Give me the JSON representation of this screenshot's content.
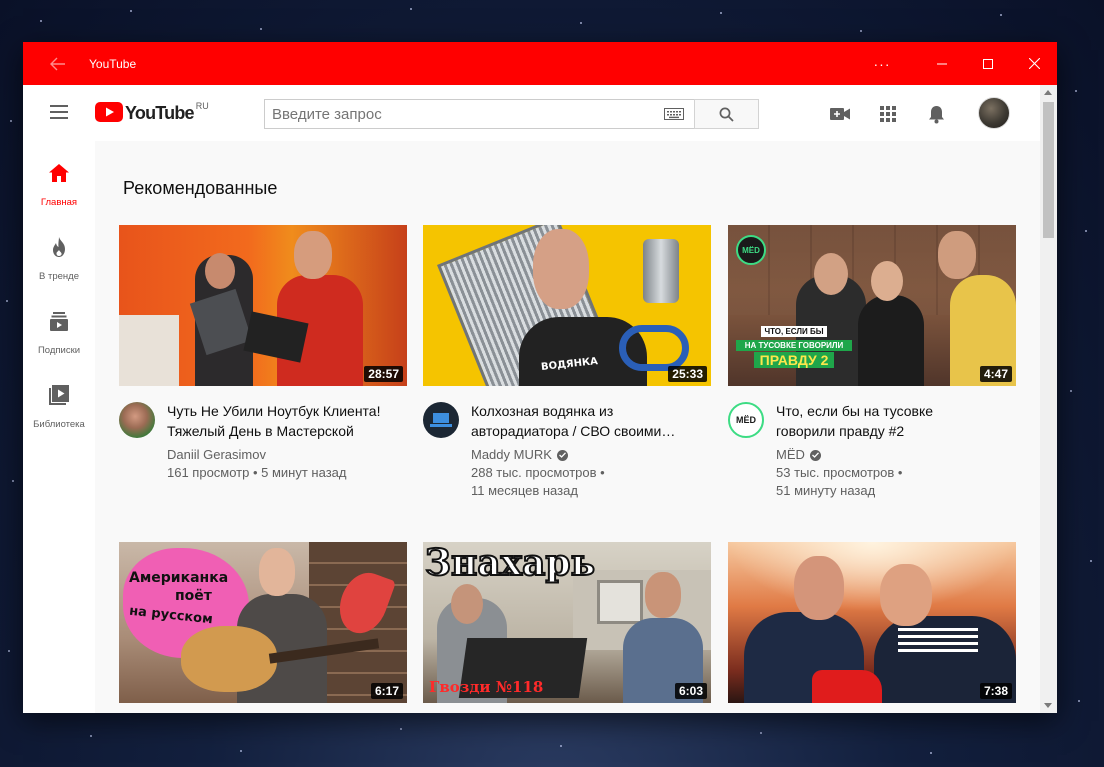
{
  "window": {
    "title": "YouTube",
    "more_label": "···"
  },
  "masthead": {
    "logo_word": "YouTube",
    "logo_country": "RU",
    "search_placeholder": "Введите запрос"
  },
  "sidebar": {
    "items": [
      {
        "label": "Главная",
        "icon": "home-icon",
        "active": true
      },
      {
        "label": "В тренде",
        "icon": "fire-icon",
        "active": false
      },
      {
        "label": "Подписки",
        "icon": "subscriptions-icon",
        "active": false
      },
      {
        "label": "Библиотека",
        "icon": "library-icon",
        "active": false
      }
    ]
  },
  "main": {
    "section_title": "Рекомендованные",
    "videos": [
      {
        "title_line1": "Чуть Не Убили Ноутбук Клиента!",
        "title_line2": "Тяжелый День в Мастерской",
        "channel": "Daniil Gerasimov",
        "verified": false,
        "stats_line1": "161 просмотр • 5 минут назад",
        "stats_line2": "",
        "duration": "28:57"
      },
      {
        "title_line1": "Колхозная водянка из",
        "title_line2": "авторадиатора / СВО своими…",
        "channel": "Maddy MURK",
        "verified": true,
        "stats_line1": "288 тыс. просмотров •",
        "stats_line2": "11 месяцев назад",
        "duration": "25:33"
      },
      {
        "title_line1": "Что, если бы на тусовке",
        "title_line2": "говорили правду #2",
        "channel": "MЁD",
        "verified": true,
        "stats_line1": "53 тыс. просмотров •",
        "stats_line2": "51 минуту назад",
        "duration": "4:47"
      },
      {
        "duration": "6:17"
      },
      {
        "duration": "6:03"
      },
      {
        "duration": "7:38"
      }
    ],
    "overlays": {
      "v3_badge": "MËD",
      "v3_caption1": "ЧТО, ЕСЛИ БЫ",
      "v3_caption2": "НА ТУСОВКЕ ГОВОРИЛИ",
      "v3_caption3": "ПРАВДУ 2",
      "v2_shirt": "ВОДЯНКА",
      "v4_line1": "Американка",
      "v4_line2": "поёт",
      "v4_line3": "на русском",
      "v5_title": "Знахарь",
      "v5_footer": "Гвозди №118"
    }
  },
  "colors": {
    "brand_red": "#ff0000",
    "text_primary": "#0f0f0f",
    "text_secondary": "#606060"
  }
}
